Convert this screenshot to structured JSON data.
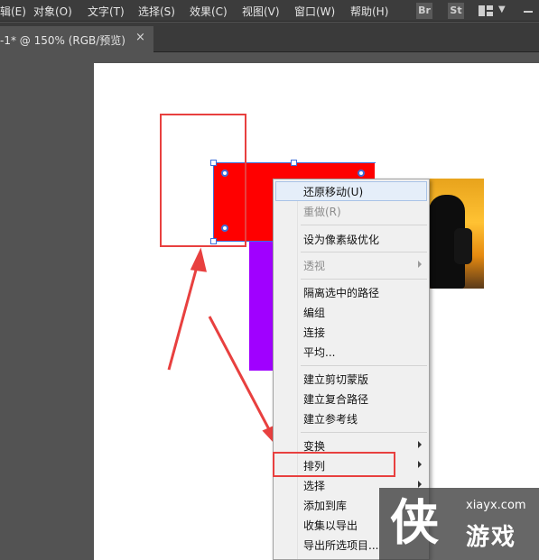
{
  "menubar": {
    "items": [
      "辑(E)",
      "对象(O)",
      "文字(T)",
      "选择(S)",
      "效果(C)",
      "视图(V)",
      "窗口(W)",
      "帮助(H)"
    ],
    "bridge_label": "Br",
    "stock_label": "St",
    "icons": [
      "bridge-icon",
      "stock-icon",
      "workspace-layout-icon",
      "chevron-down-icon",
      "minimize-icon"
    ]
  },
  "document_tab": {
    "title": "-1* @ 150% (RGB/预览)",
    "close": "×"
  },
  "context_menu": {
    "items": [
      {
        "label": "还原移动(U)",
        "enabled": true,
        "highlighted": true,
        "submenu": false
      },
      {
        "label": "重做(R)",
        "enabled": false,
        "submenu": false
      },
      {
        "label": "设为像素级优化",
        "enabled": true,
        "submenu": false
      },
      {
        "label": "透视",
        "enabled": false,
        "submenu": true
      },
      {
        "label": "隔离选中的路径",
        "enabled": true,
        "submenu": false
      },
      {
        "label": "编组",
        "enabled": true,
        "submenu": false
      },
      {
        "label": "连接",
        "enabled": true,
        "submenu": false
      },
      {
        "label": "平均...",
        "enabled": true,
        "submenu": false
      },
      {
        "label": "建立剪切蒙版",
        "enabled": true,
        "submenu": false
      },
      {
        "label": "建立复合路径",
        "enabled": true,
        "submenu": false
      },
      {
        "label": "建立参考线",
        "enabled": true,
        "submenu": false
      },
      {
        "label": "变换",
        "enabled": true,
        "submenu": true
      },
      {
        "label": "排列",
        "enabled": true,
        "submenu": true
      },
      {
        "label": "选择",
        "enabled": true,
        "submenu": true
      },
      {
        "label": "添加到库",
        "enabled": true,
        "submenu": false
      },
      {
        "label": "收集以导出",
        "enabled": true,
        "submenu": true
      },
      {
        "label": "导出所选项目...",
        "enabled": true,
        "submenu": false
      }
    ]
  },
  "annotations": {
    "color": "#e8403f"
  },
  "colors": {
    "red_shape": "#ff0000",
    "purple_shape": "#a000ff",
    "selection": "#3d6fd9"
  },
  "watermark": {
    "glyph": "侠",
    "url": "xiayx.com",
    "name": "游戏"
  }
}
